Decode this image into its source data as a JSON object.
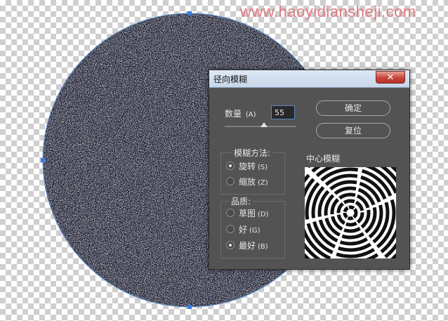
{
  "watermark": "www.haoyidiansheji.com",
  "dialog": {
    "title": "径向模糊",
    "close_glyph": "✕",
    "amount_label": "数量",
    "amount_key": "(A)",
    "amount_value": "55",
    "amount_slider_fraction": 0.55,
    "ok_label": "确定",
    "reset_label": "复位",
    "blur_method": {
      "title": "模糊方法:",
      "options": [
        {
          "label": "旋转",
          "key": "(S)",
          "selected": true
        },
        {
          "label": "缩放",
          "key": "(Z)",
          "selected": false
        }
      ]
    },
    "quality": {
      "title": "品质:",
      "options": [
        {
          "label": "草图",
          "key": "(D)",
          "selected": false
        },
        {
          "label": "好",
          "key": "(G)",
          "selected": false
        },
        {
          "label": "最好",
          "key": "(B)",
          "selected": true
        }
      ]
    },
    "center_label": "中心模糊"
  },
  "colors": {
    "dialog_bg": "#535353",
    "selection_border": "#4a90d9",
    "watermark": "#e07a82"
  }
}
